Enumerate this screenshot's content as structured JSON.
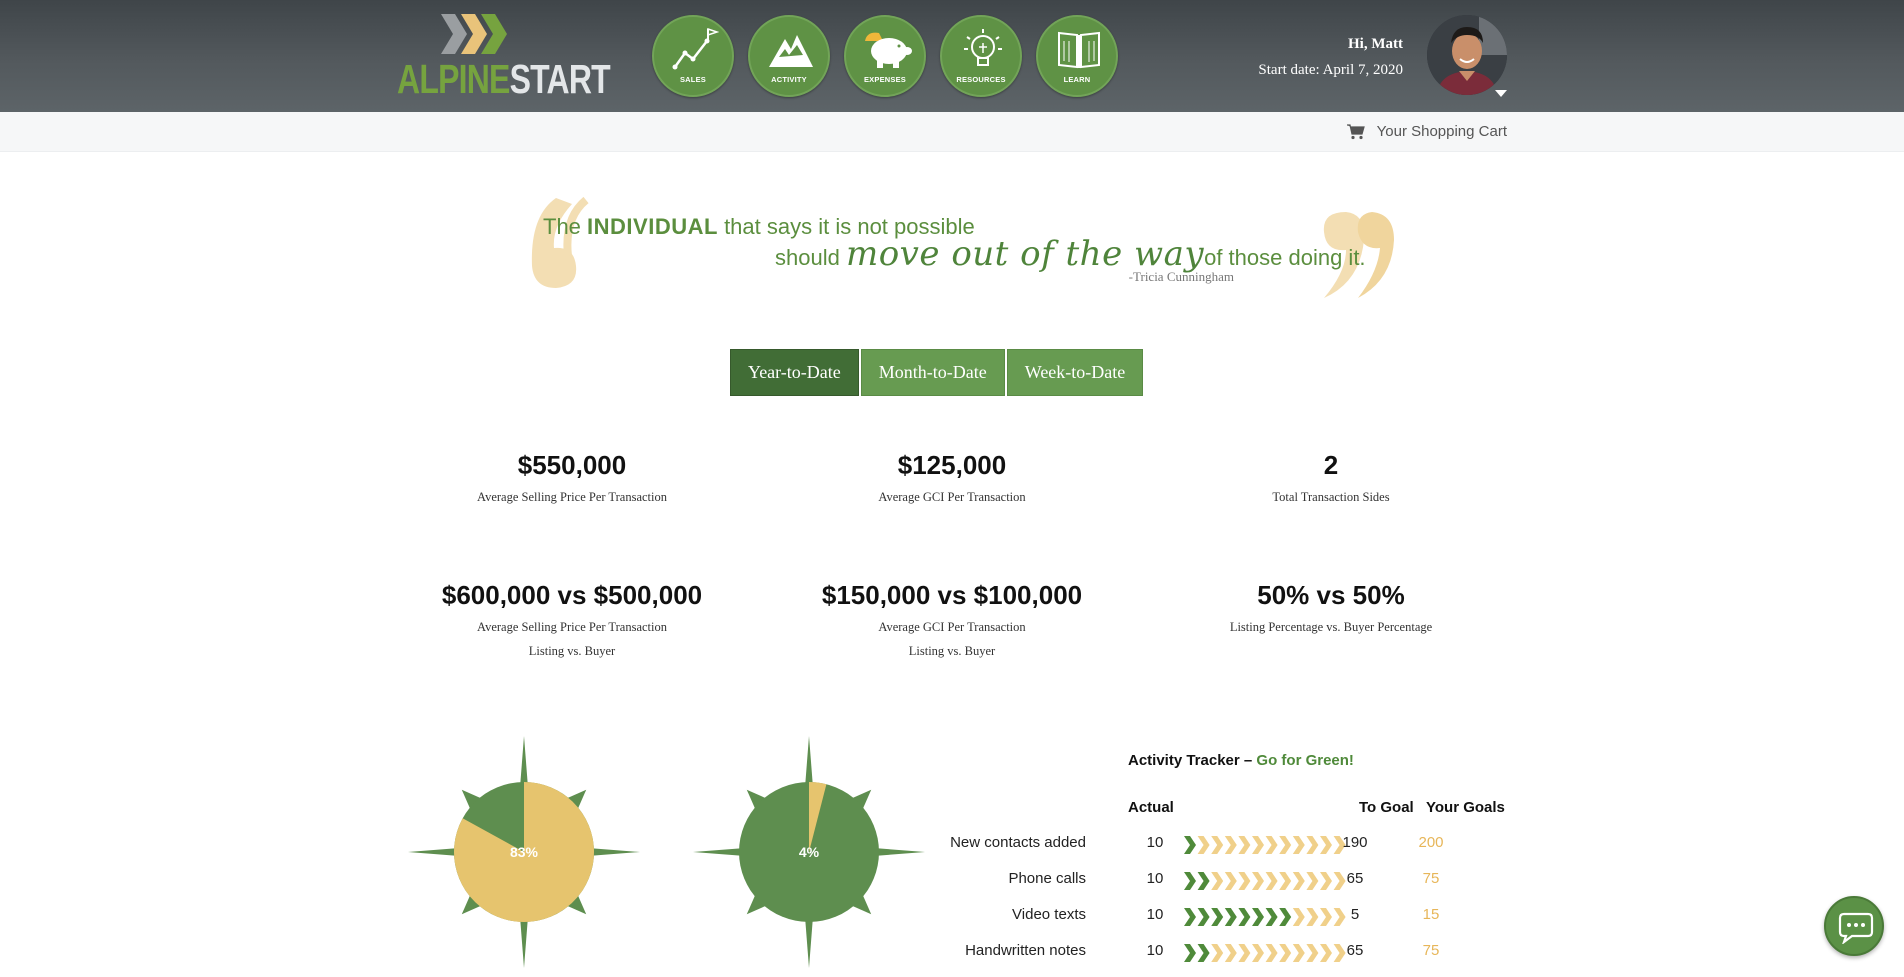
{
  "header": {
    "logo": {
      "part1": "ALPINE",
      "part2": "START"
    },
    "nav": [
      {
        "label": "SALES",
        "icon": "sales-chart-flag-icon"
      },
      {
        "label": "ACTIVITY",
        "icon": "mountain-icon"
      },
      {
        "label": "EXPENSES",
        "icon": "piggy-bank-icon"
      },
      {
        "label": "RESOURCES",
        "icon": "lightbulb-icon"
      },
      {
        "label": "LEARN",
        "icon": "book-icon"
      }
    ],
    "greeting": "Hi, Matt",
    "start_date": "Start date: April 7, 2020"
  },
  "cart": {
    "label": "Your Shopping Cart",
    "icon": "shopping-cart-icon"
  },
  "quote": {
    "the": "The",
    "individual": "INDIVIDUAL",
    "rest1": "that says it is not possible",
    "should": "should",
    "script": "move out of the way",
    "rest2": "of those doing it.",
    "author": "-Tricia Cunningham"
  },
  "tabs": [
    {
      "label": "Year-to-Date",
      "active": true
    },
    {
      "label": "Month-to-Date",
      "active": false
    },
    {
      "label": "Week-to-Date",
      "active": false
    }
  ],
  "stats": [
    {
      "value": "$550,000",
      "label": "Average Selling Price Per Transaction",
      "label2": ""
    },
    {
      "value": "$125,000",
      "label": "Average GCI Per Transaction",
      "label2": ""
    },
    {
      "value": "2",
      "label": "Total Transaction Sides",
      "label2": ""
    },
    {
      "value": "$600,000 vs $500,000",
      "label": "Average Selling Price Per Transaction",
      "label2": "Listing vs. Buyer"
    },
    {
      "value": "$150,000 vs $100,000",
      "label": "Average GCI Per Transaction",
      "label2": "Listing vs. Buyer"
    },
    {
      "value": "50% vs 50%",
      "label": "Listing Percentage vs. Buyer Percentage",
      "label2": ""
    }
  ],
  "pies": [
    {
      "percent": 83,
      "label": "83%"
    },
    {
      "percent": 4,
      "label": "4%"
    }
  ],
  "colors": {
    "green": "#5e8e4f",
    "gold": "#e6c46e",
    "dark_green": "#416d36",
    "goal_gold": "#e7b659"
  },
  "tracker": {
    "title": "Activity Tracker –",
    "title_accent": "Go for Green!",
    "headers": {
      "actual": "Actual",
      "to_goal": "To Goal",
      "goals": "Your Goals"
    },
    "rows": [
      {
        "label": "New contacts added",
        "actual": "10",
        "to_goal": "190",
        "goal": "200",
        "fraction": 0.05
      },
      {
        "label": "Phone calls",
        "actual": "10",
        "to_goal": "65",
        "goal": "75",
        "fraction": 0.13
      },
      {
        "label": "Video texts",
        "actual": "10",
        "to_goal": "5",
        "goal": "15",
        "fraction": 0.67
      },
      {
        "label": "Handwritten notes",
        "actual": "10",
        "to_goal": "65",
        "goal": "75",
        "fraction": 0.13
      }
    ]
  },
  "chat": {
    "icon": "chat-bubble-icon"
  }
}
